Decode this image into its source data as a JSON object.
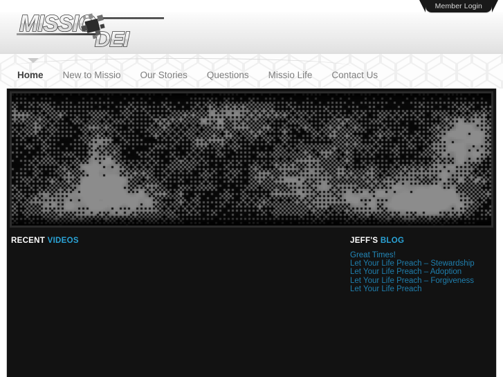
{
  "topbar": {
    "member_login_label": "Member Login"
  },
  "header": {
    "logo_primary": "MISSIO",
    "logo_secondary": "DEI",
    "logo_alt": "Missio Dei"
  },
  "nav": {
    "items": [
      {
        "label": "Home",
        "active": true
      },
      {
        "label": "New to Missio",
        "active": false
      },
      {
        "label": "Our Stories",
        "active": false
      },
      {
        "label": "Questions",
        "active": false
      },
      {
        "label": "Missio Life",
        "active": false
      },
      {
        "label": "Contact Us",
        "active": false
      }
    ]
  },
  "hero": {
    "alt": "dark banner image"
  },
  "main": {
    "videos": {
      "title_strong": "RECENT",
      "title_accent": "VIDEOS",
      "items": []
    },
    "blog": {
      "title_strong": "JEFF'S",
      "title_accent": "BLOG",
      "items": [
        "Great Times!",
        "Let Your Life Preach – Stewardship",
        "Let Your Life Preach – Adoption",
        "Let Your Life Preach – Forgiveness",
        "Let Your Life Preach"
      ]
    }
  },
  "colors": {
    "accent_blue": "#2aa3d6",
    "link_blue": "#1f7fae",
    "dark_panel": "#121212",
    "login_tab": "#191919"
  }
}
